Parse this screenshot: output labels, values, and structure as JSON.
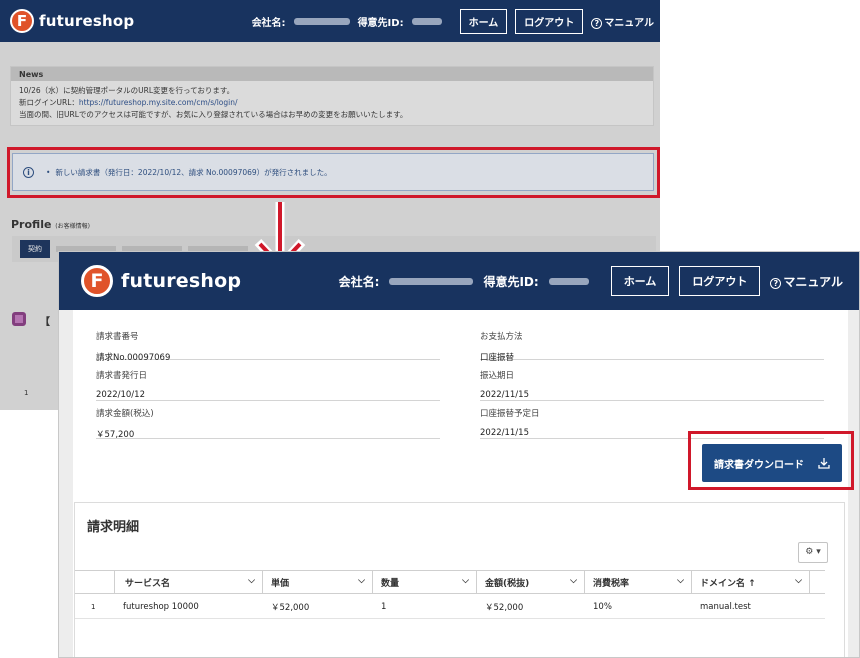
{
  "colors": {
    "brand_navy": "#18335f",
    "logo_orange": "#e0532a",
    "highlight_red": "#d0182a",
    "button_blue": "#1d4a84"
  },
  "back": {
    "header": {
      "logo_letter": "F",
      "logo_text": "futureshop",
      "company_label": "会社名:",
      "customer_id_label": "得意先ID:",
      "home": "ホーム",
      "logout": "ログアウト",
      "manual": "マニュアル"
    },
    "news": {
      "title": "News",
      "line1": "10/26（水）に契約管理ポータルのURL変更を行っております。",
      "line2_label": "新ログインURL：",
      "line2_url": "https://futureshop.my.site.com/cm/s/login/",
      "line3": "当面の間、旧URLでのアクセスは可能ですが、お気に入り登録されている場合はお早めの変更をお願いいたします。"
    },
    "alert": "新しい請求書（発行日：2022/10/12、請求 No.00097069）が発行されました。",
    "profile": {
      "title": "Profile",
      "sub": "(お客様情報)",
      "tab": "契約"
    },
    "bracket": "【",
    "row_index": "1"
  },
  "front": {
    "header": {
      "logo_letter": "F",
      "logo_text": "futureshop",
      "company_label": "会社名:",
      "customer_id_label": "得意先ID:",
      "home": "ホーム",
      "logout": "ログアウト",
      "manual": "マニュアル"
    },
    "fields_left": [
      {
        "label": "請求書番号",
        "value": "請求No.00097069"
      },
      {
        "label": "請求書発行日",
        "value": "2022/10/12"
      },
      {
        "label": "請求金額(税込)",
        "value": "￥57,200"
      }
    ],
    "fields_right": [
      {
        "label": "お支払方法",
        "value": "口座振替"
      },
      {
        "label": "振込期日",
        "value": "2022/11/15"
      },
      {
        "label": "口座振替予定日",
        "value": "2022/11/15"
      }
    ],
    "download_button": "請求書ダウンロード",
    "detail": {
      "title": "請求明細",
      "gear": "⚙ ▾",
      "columns": [
        "",
        "サービス名",
        "単価",
        "数量",
        "金額(税抜)",
        "消費税率",
        "ドメイン名 ↑"
      ],
      "rows": [
        [
          "1",
          "futureshop 10000",
          "￥52,000",
          "1",
          "￥52,000",
          "10%",
          "manual.test"
        ]
      ]
    }
  }
}
